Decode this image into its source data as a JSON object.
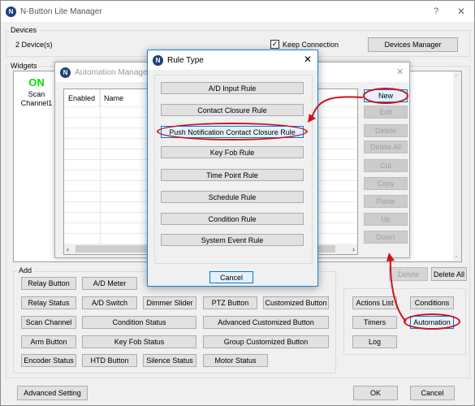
{
  "main_window": {
    "title": "N-Button Lite Manager",
    "help_label": "?",
    "close_label": "✕",
    "devices": {
      "group_label": "Devices",
      "count_text": "2 Device(s)",
      "keep_connection_label": "Keep Connection",
      "keep_connection_checked": true,
      "devices_manager_label": "Devices Manager"
    },
    "widgets": {
      "group_label": "Widgets",
      "widget_state": "ON",
      "widget_state_color": "#00e000",
      "widget_name": "Scan Channel1",
      "delete_label": "Delete",
      "delete_all_label": "Delete All"
    },
    "add": {
      "group_label": "Add",
      "buttons": [
        "Relay Button",
        "A/D Meter",
        "Relay Status",
        "A/D Switch",
        "Dimmer Slider",
        "PTZ Button",
        "Customized Button",
        "Scan Channel",
        "Condition Status",
        "Advanced Customized Button",
        "Arm Button",
        "Key Fob Status",
        "Group Customized Button",
        "Encoder Status",
        "HTD Button",
        "Silence Status",
        "Motor Status"
      ]
    },
    "side_buttons": {
      "actions_list": "Actions List",
      "conditions": "Conditions",
      "timers": "Timers",
      "automation": "Automation",
      "log": "Log"
    },
    "advanced_setting_label": "Advanced Setting",
    "ok_label": "OK",
    "cancel_label": "Cancel"
  },
  "automation_manager": {
    "title": "Automation Manager",
    "close_label": "✕",
    "columns": [
      "Enabled",
      "Name"
    ],
    "buttons": {
      "new": "New",
      "edit": "Edit",
      "delete": "Delete",
      "delete_all": "Delete All",
      "cut": "Cut",
      "copy": "Copy",
      "paste": "Paste",
      "up": "Up",
      "down": "Down"
    }
  },
  "rule_type": {
    "title": "Rule Type",
    "close_label": "✕",
    "rules": [
      "A/D Input Rule",
      "Contact Closure Rule",
      "Push Notification Contact Closure Rule",
      "Key Fob Rule",
      "Time Point Rule",
      "Schedule Rule",
      "Condition Rule",
      "System Event Rule"
    ],
    "highlighted_rule": "Push Notification Contact Closure Rule",
    "cancel_label": "Cancel"
  },
  "annotation_color": "#d0121b",
  "logo_letter": "N"
}
